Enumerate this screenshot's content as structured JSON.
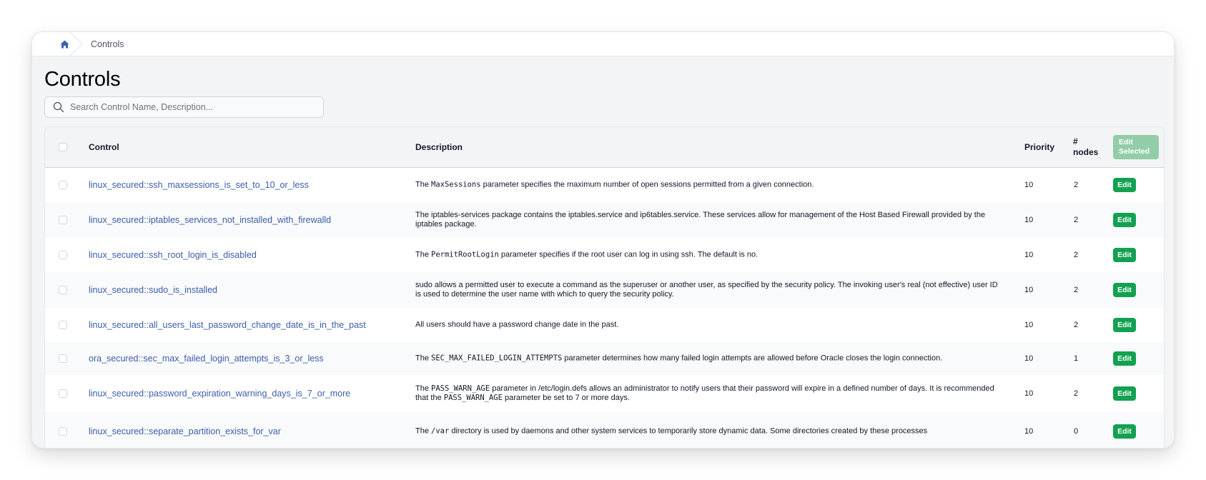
{
  "breadcrumb": {
    "home_icon": "home-icon",
    "current": "Controls"
  },
  "page": {
    "title": "Controls"
  },
  "search": {
    "placeholder": "Search Control Name, Description...",
    "value": "",
    "icon": "search-icon"
  },
  "table": {
    "columns": {
      "control": "Control",
      "description": "Description",
      "priority": "Priority",
      "nodes_line1": "#",
      "nodes_line2": "nodes"
    },
    "edit_selected_label_line1": "Edit",
    "edit_selected_label_line2": "Selected",
    "edit_label": "Edit",
    "colors": {
      "link": "#3b5ea8",
      "edit_button": "#12a150",
      "edit_selected_disabled": "#92cda8"
    },
    "rows": [
      {
        "control": "linux_secured::ssh_maxsessions_is_set_to_10_or_less",
        "description": [
          {
            "text": "The "
          },
          {
            "text": "MaxSessions",
            "code": true
          },
          {
            "text": " parameter specifies the maximum number of open sessions permitted from a given connection."
          }
        ],
        "priority": "10",
        "nodes": "2"
      },
      {
        "control": "linux_secured::iptables_services_not_installed_with_firewalld",
        "description": [
          {
            "text": "The iptables-services package contains the iptables.service and ip6tables.service. These services allow for management of the Host Based Firewall provided by the iptables package."
          }
        ],
        "priority": "10",
        "nodes": "2"
      },
      {
        "control": "linux_secured::ssh_root_login_is_disabled",
        "description": [
          {
            "text": "The "
          },
          {
            "text": "PermitRootLogin",
            "code": true
          },
          {
            "text": " parameter specifies if the root user can log in using ssh. The default is no."
          }
        ],
        "priority": "10",
        "nodes": "2"
      },
      {
        "control": "linux_secured::sudo_is_installed",
        "description": [
          {
            "text": "sudo allows a permitted user to execute a command as the superuser or another user, as specified by the security policy. The invoking user's real (not effective) user ID is used to determine the user name with which to query the security policy."
          }
        ],
        "priority": "10",
        "nodes": "2"
      },
      {
        "control": "linux_secured::all_users_last_password_change_date_is_in_the_past",
        "description": [
          {
            "text": "All users should have a password change date in the past."
          }
        ],
        "priority": "10",
        "nodes": "2"
      },
      {
        "control": "ora_secured::sec_max_failed_login_attempts_is_3_or_less",
        "description": [
          {
            "text": "The "
          },
          {
            "text": "SEC_MAX_FAILED_LOGIN_ATTEMPTS",
            "code": true
          },
          {
            "text": " parameter determines how many failed login attempts are allowed before Oracle closes the login connection."
          }
        ],
        "priority": "10",
        "nodes": "1"
      },
      {
        "control": "linux_secured::password_expiration_warning_days_is_7_or_more",
        "description": [
          {
            "text": "The "
          },
          {
            "text": "PASS_WARN_AGE",
            "code": true
          },
          {
            "text": " parameter in /etc/login.defs allows an administrator to notify users that their password will expire in a defined number of days. It is recommended that the "
          },
          {
            "text": "PASS_WARN_AGE",
            "code": true
          },
          {
            "text": " parameter be set to 7 or more days."
          }
        ],
        "priority": "10",
        "nodes": "2"
      },
      {
        "control": "linux_secured::separate_partition_exists_for_var",
        "description": [
          {
            "text": "The "
          },
          {
            "text": "/var",
            "code": true
          },
          {
            "text": " directory is used by daemons and other system services to temporarily store dynamic data. Some directories created by these processes"
          }
        ],
        "priority": "10",
        "nodes": "0"
      }
    ]
  }
}
